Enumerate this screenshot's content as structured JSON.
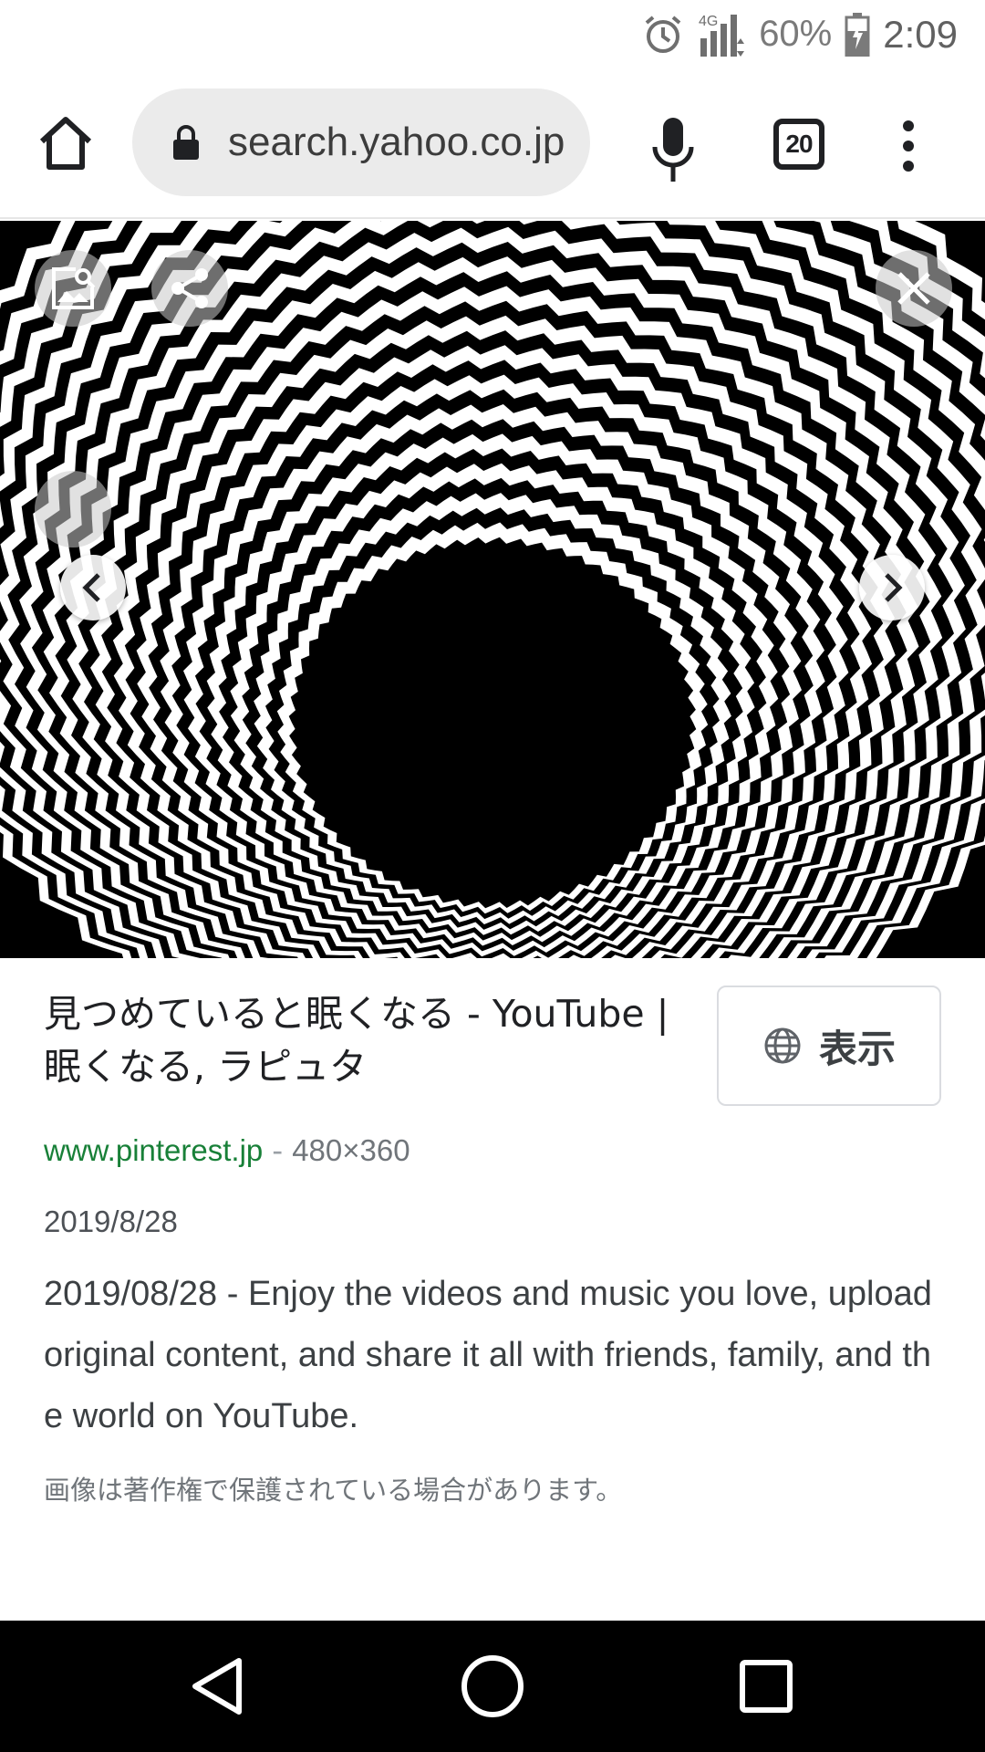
{
  "status_bar": {
    "time": "2:09",
    "battery_percent": "60%",
    "network": "4G",
    "icons": [
      "alarm-icon",
      "signal-icon",
      "battery-icon"
    ]
  },
  "browser": {
    "url": "search.yahoo.co.jp",
    "tab_count": "20",
    "icons": [
      "home-icon",
      "lock-icon",
      "mic-icon",
      "tabs-icon",
      "more-vert-icon"
    ]
  },
  "viewer": {
    "icons": [
      "image-search-icon",
      "share-icon",
      "close-icon",
      "chevron-left-icon",
      "chevron-right-icon"
    ]
  },
  "result": {
    "title": "見つめていると眠くなる - YouTube | 眠くなる, ラピュタ",
    "view_button_label": "表示",
    "domain": "www.pinterest.jp",
    "separator": "-",
    "dimensions": "480×360",
    "date": "2019/8/28",
    "description": "2019/08/28 - Enjoy the videos and music you love, upload original content, and share it all with friends, family, and the world on YouTube.",
    "copyright_notice": "画像は著作権で保護されている場合があります。"
  },
  "system_nav": {
    "icons": [
      "back-icon",
      "home-circle-icon",
      "recents-icon"
    ]
  },
  "colors": {
    "link_green": "#188038",
    "pill_gray": "#ebebeb",
    "nav_black": "#000000"
  }
}
